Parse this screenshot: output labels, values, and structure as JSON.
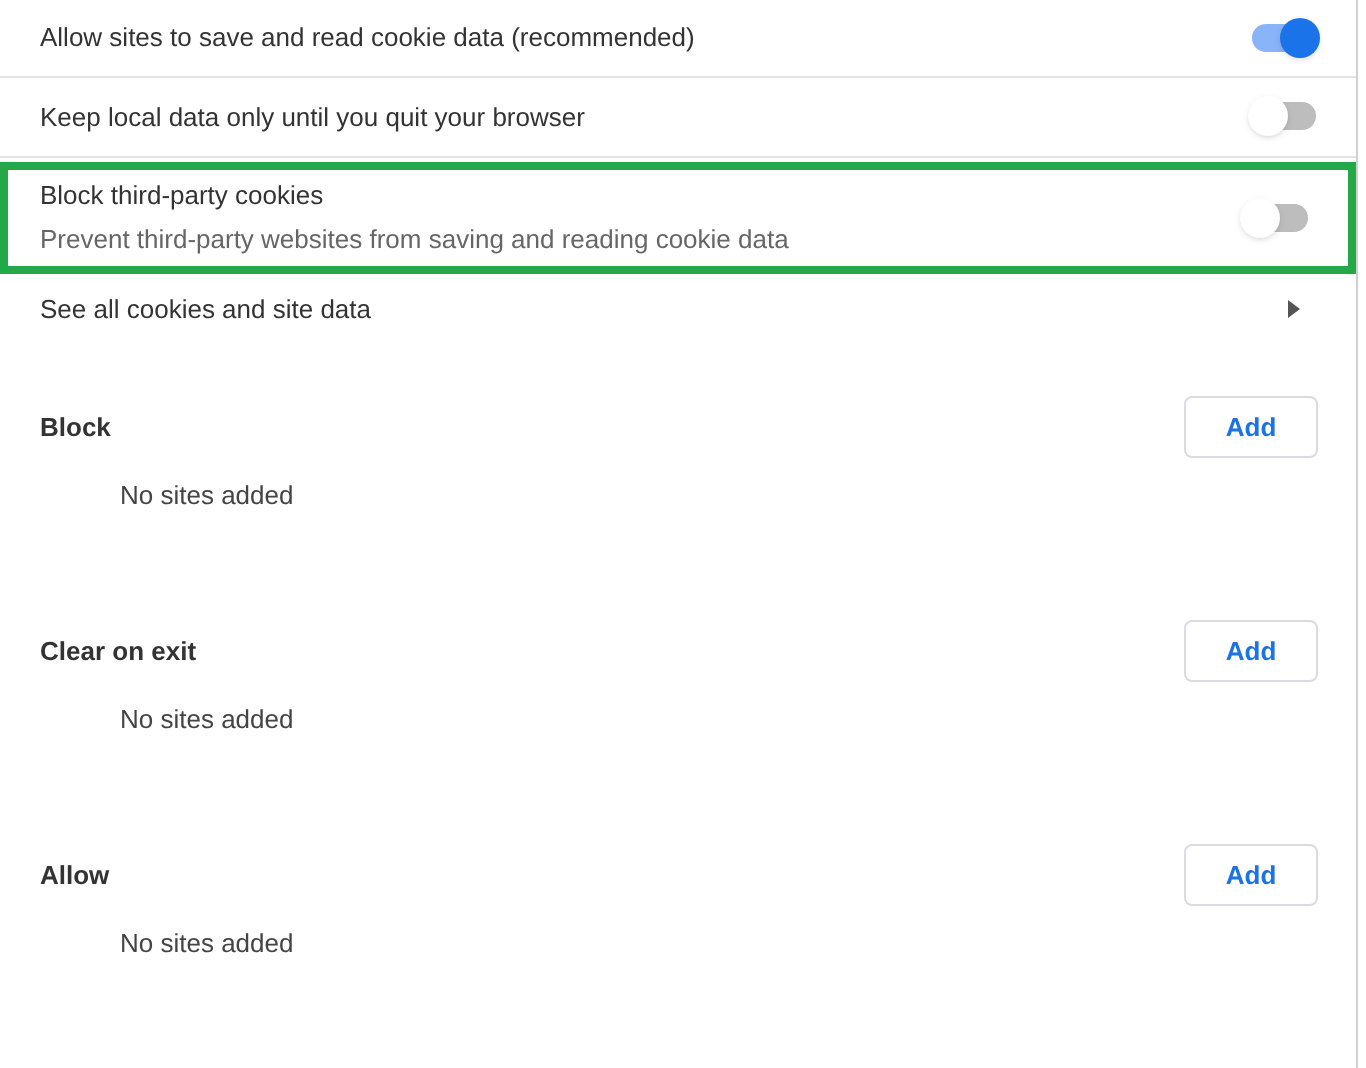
{
  "toggles": [
    {
      "label": "Allow sites to save and read cookie data (recommended)",
      "on": true,
      "highlighted": false
    },
    {
      "label": "Keep local data only until you quit your browser",
      "on": false,
      "highlighted": false
    },
    {
      "label": "Block third-party cookies",
      "description": "Prevent third-party websites from saving and reading cookie data",
      "on": false,
      "highlighted": true
    }
  ],
  "link": {
    "label": "See all cookies and site data"
  },
  "sections": [
    {
      "title": "Block",
      "button": "Add",
      "empty": "No sites added"
    },
    {
      "title": "Clear on exit",
      "button": "Add",
      "empty": "No sites added"
    },
    {
      "title": "Allow",
      "button": "Add",
      "empty": "No sites added"
    }
  ]
}
